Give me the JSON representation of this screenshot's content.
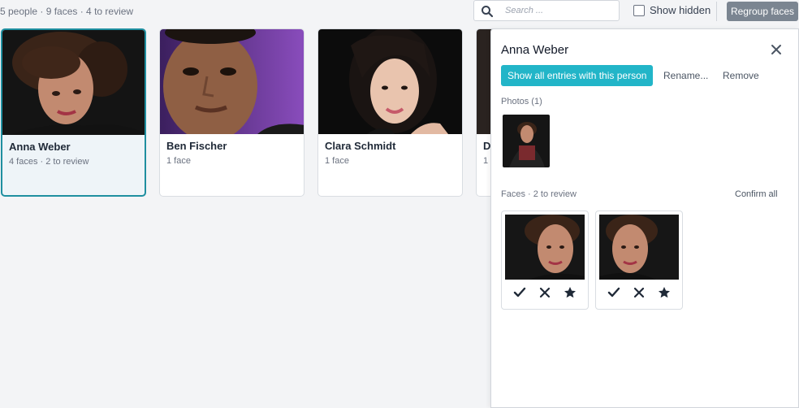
{
  "summary": "5 people · 9 faces · 4 to review",
  "search": {
    "placeholder": "Search ...",
    "value": "",
    "icon": "search-icon"
  },
  "show_hidden": {
    "label": "Show hidden",
    "checked": false
  },
  "regroup_label": "Regroup faces",
  "colors": {
    "accent": "#22b5c8",
    "selected_border": "#1f8fa0",
    "regroup_bg": "#7b8591"
  },
  "people": [
    {
      "name": "Anna Weber",
      "meta": "4 faces · 2 to review",
      "selected": true
    },
    {
      "name": "Ben Fischer",
      "meta": "1 face",
      "selected": false
    },
    {
      "name": "Clara Schmidt",
      "meta": "1 face",
      "selected": false
    },
    {
      "name": "D",
      "meta": "1",
      "selected": false
    }
  ],
  "panel": {
    "title": "Anna Weber",
    "show_entries_label": "Show all entries with this person",
    "rename_label": "Rename...",
    "remove_label": "Remove",
    "photos_label": "Photos (1)",
    "faces_label": "Faces · 2 to review",
    "confirm_all_label": "Confirm all",
    "face_actions": [
      "check-icon",
      "reject-x-icon",
      "star-icon"
    ]
  }
}
